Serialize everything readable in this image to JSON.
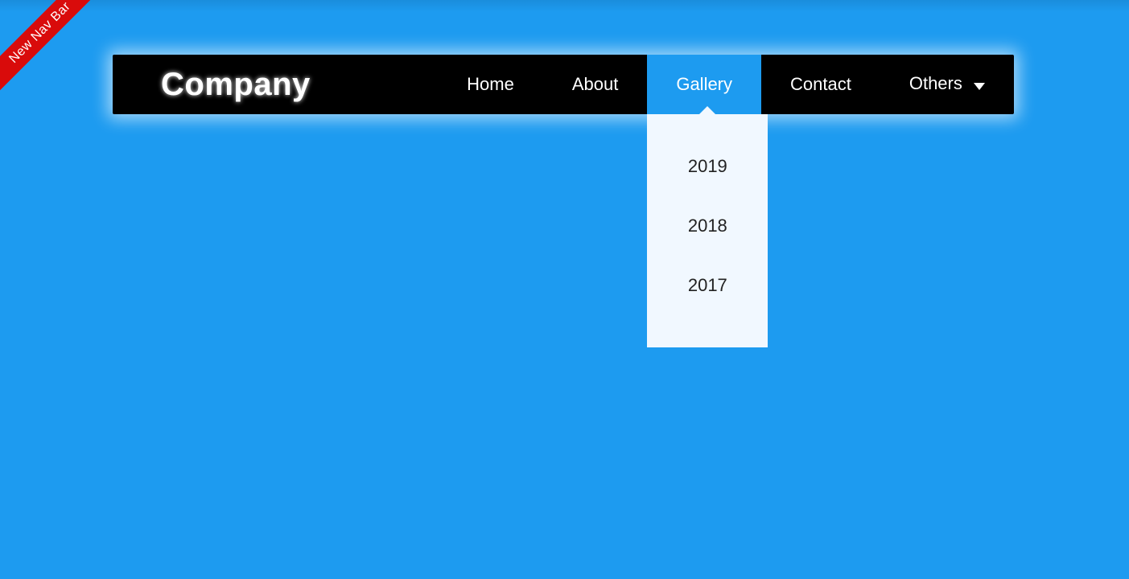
{
  "ribbon": {
    "label": "New Nav Bar"
  },
  "brand": "Company",
  "nav": {
    "items": [
      {
        "label": "Home",
        "active": false,
        "hasDropdown": false,
        "hasCaret": false
      },
      {
        "label": "About",
        "active": false,
        "hasDropdown": false,
        "hasCaret": false
      },
      {
        "label": "Gallery",
        "active": true,
        "hasDropdown": true,
        "hasCaret": false,
        "dropdown": [
          {
            "label": "2019"
          },
          {
            "label": "2018"
          },
          {
            "label": "2017"
          }
        ]
      },
      {
        "label": "Contact",
        "active": false,
        "hasDropdown": false,
        "hasCaret": false
      },
      {
        "label": "Others",
        "active": false,
        "hasDropdown": false,
        "hasCaret": true
      }
    ]
  }
}
